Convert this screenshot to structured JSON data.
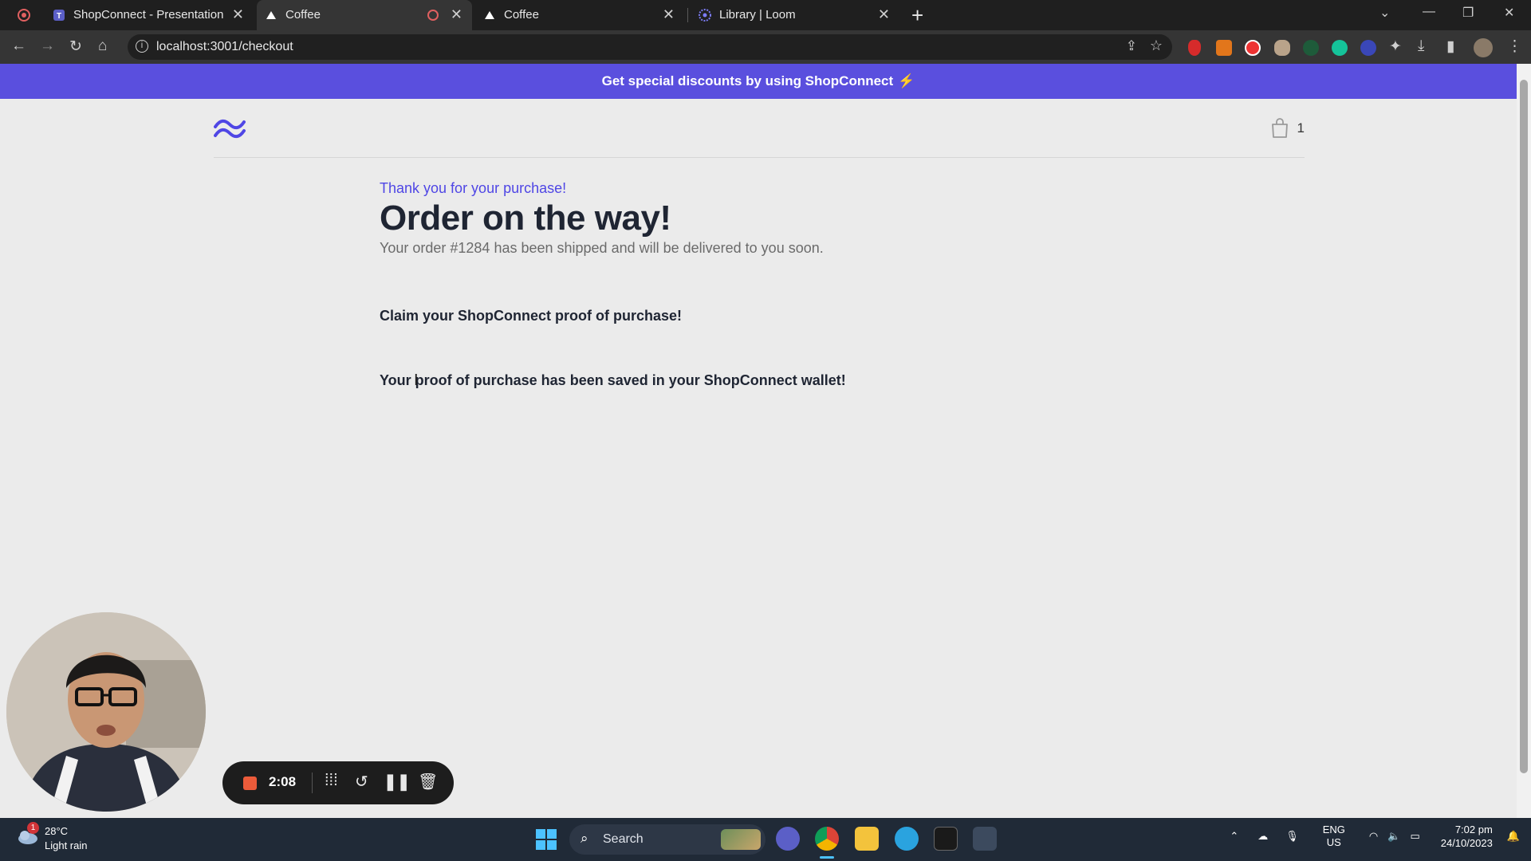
{
  "browser": {
    "tabs": [
      {
        "label": "ShopConnect - Presentation",
        "active": false
      },
      {
        "label": "Coffee",
        "active": true
      },
      {
        "label": "Coffee",
        "active": false
      },
      {
        "label": "Library | Loom",
        "active": false
      }
    ],
    "url": "localhost:3001/checkout"
  },
  "promo": {
    "text": "Get special discounts by using ShopConnect",
    "bolt": "⚡"
  },
  "header": {
    "cart_count": "1"
  },
  "main": {
    "thanks": "Thank you for your purchase!",
    "title": "Order on the way!",
    "subtitle": "Your order #1284 has been shipped and will be delivered to you soon.",
    "claim": "Claim your ShopConnect proof of purchase!",
    "saved": "Your proof of purchase has been saved in your ShopConnect wallet!"
  },
  "loom": {
    "time": "2:08"
  },
  "taskbar": {
    "weather_temp": "28°C",
    "weather_desc": "Light rain",
    "weather_badge": "1",
    "search_placeholder": "Search",
    "lang": "ENG",
    "region": "US",
    "time": "7:02 pm",
    "date": "24/10/2023"
  },
  "colors": {
    "brand": "#5a4fde",
    "accent_text": "#4f46e5",
    "loom_red": "#ec5b3a"
  }
}
